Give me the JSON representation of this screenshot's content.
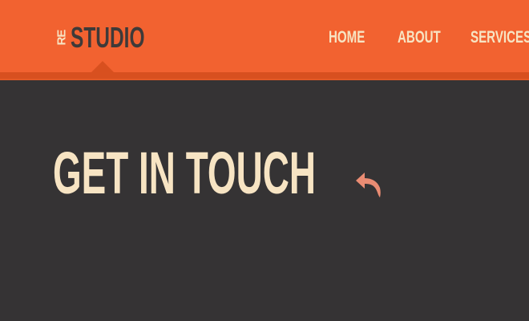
{
  "header": {
    "logo_prefix": "RE",
    "logo_main": "STUDIO",
    "nav": [
      {
        "label": "HOME"
      },
      {
        "label": "ABOUT"
      },
      {
        "label": "SERVICES"
      }
    ]
  },
  "main": {
    "headline": "GET IN TOUCH",
    "back_icon": "reply-arrow-icon"
  },
  "colors": {
    "header_bg": "#f26230",
    "header_stripe": "#d8501f",
    "page_bg": "#353334",
    "text_light": "#f7e4c3",
    "logo_dark": "#3e3a39",
    "icon_accent": "#ea8c73"
  }
}
